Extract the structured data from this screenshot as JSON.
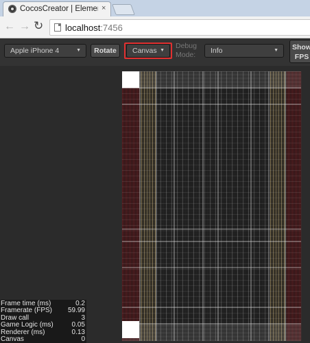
{
  "browser": {
    "tab_title": "CocosCreator | Elemen",
    "tab_close": "×",
    "favicon": "cocos-logo-icon",
    "url_host": "localhost",
    "url_port": ":7456",
    "nav": {
      "back": "←",
      "forward": "→",
      "reload": "↻"
    }
  },
  "toolbar": {
    "device": "Apple iPhone 4",
    "rotate_label": "Rotate",
    "renderer": "Canvas",
    "debug_label": "Debug Mode:",
    "debug_mode": "Info",
    "show_fps_label": "Show FPS",
    "dropdown_arrow": "▼",
    "highlight_color": "#e23030"
  },
  "game": {
    "background_color": "#111111",
    "grid_colors": {
      "red": "#8a1e24",
      "yellow": "#e6c98a",
      "white": "#f0f0f0"
    }
  },
  "stats": [
    {
      "label": "Frame time (ms)",
      "value": "0.2"
    },
    {
      "label": "Framerate (FPS)",
      "value": "59.99"
    },
    {
      "label": "Draw call",
      "value": "3"
    },
    {
      "label": "Game Logic (ms)",
      "value": "0.05"
    },
    {
      "label": "Renderer (ms)",
      "value": "0.13"
    },
    {
      "label": "Canvas",
      "value": "0"
    }
  ]
}
